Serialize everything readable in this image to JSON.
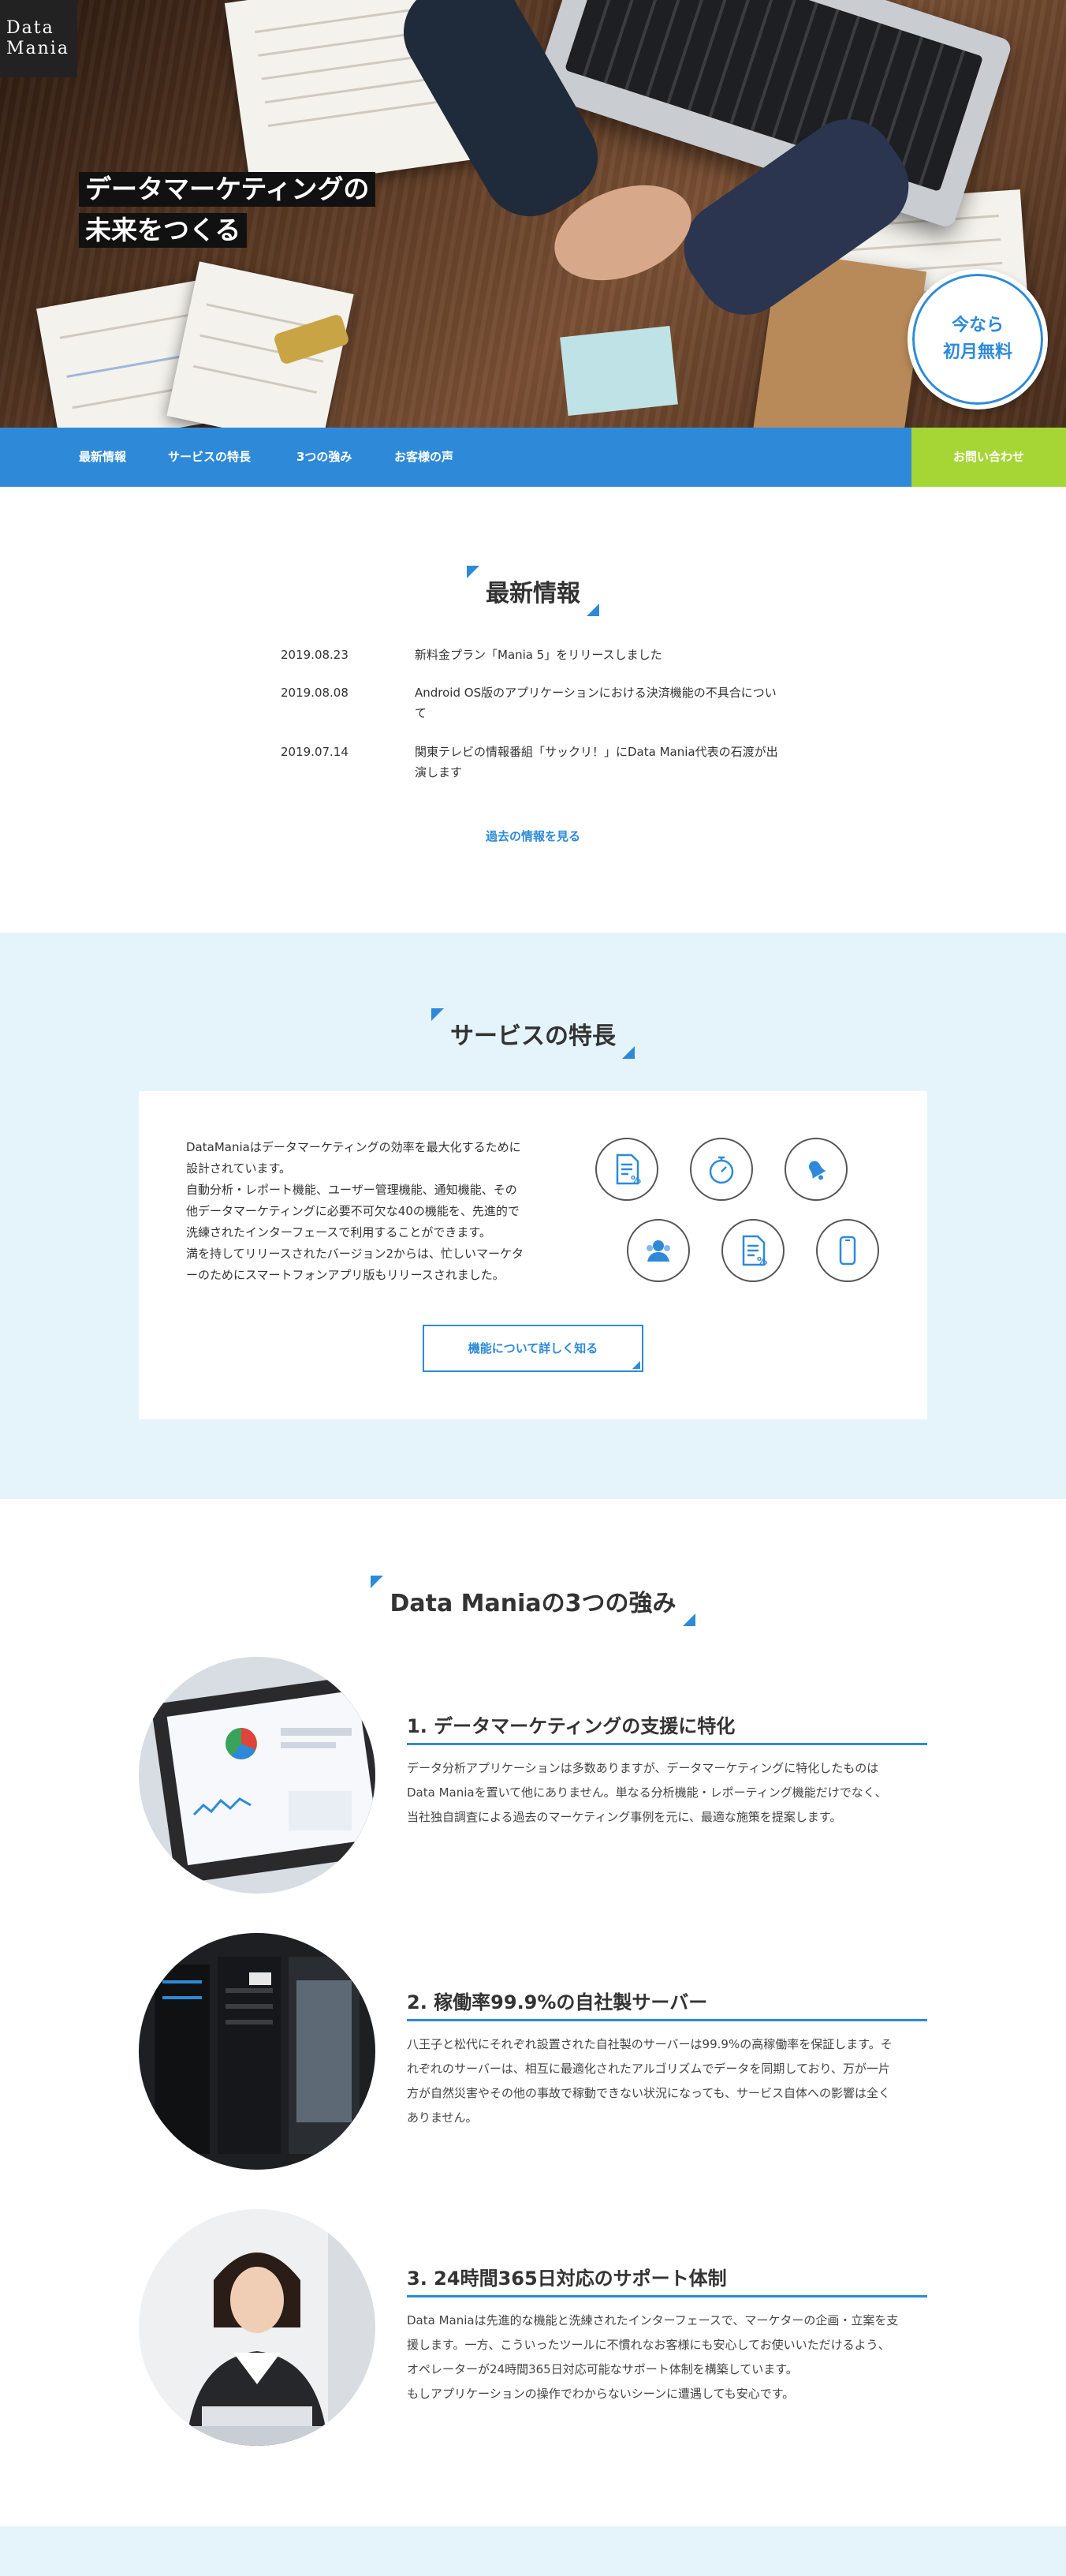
{
  "logo": {
    "line1": "Data",
    "line2": "Mania"
  },
  "hero": {
    "headline_line1": "データマーケティングの",
    "headline_line2": "未来をつくる",
    "badge_line1": "今なら",
    "badge_line2": "初月無料"
  },
  "nav": {
    "items": [
      {
        "label": "最新情報"
      },
      {
        "label": "サービスの特長"
      },
      {
        "label": "3つの強み"
      },
      {
        "label": "お客様の声"
      }
    ],
    "cta_label": "お問い合わせ"
  },
  "news": {
    "title": "最新情報",
    "items": [
      {
        "date": "2019.08.23",
        "text": "新料金プラン「Mania 5」をリリースしました"
      },
      {
        "date": "2019.08.08",
        "text": "Android OS版のアプリケーションにおける決済機能の不具合について"
      },
      {
        "date": "2019.07.14",
        "text": "関東テレビの情報番組「サックリ！」にData Mania代表の石渡が出演します"
      }
    ],
    "more_label": "過去の情報を見る"
  },
  "features": {
    "title": "サービスの特長",
    "description": "DataManiaはデータマーケティングの効率を最大化するために\n設計されています。\n自動分析・レポート機能、ユーザー管理機能、通知機能、その\n他データマーケティングに必要不可欠な40の機能を、先進的で\n洗練されたインターフェースで利用することができます。\n満を持してリリースされたバージョン2からは、忙しいマーケタ\nーのためにスマートフォンアプリ版もリリースされました。",
    "icons": [
      "report-icon",
      "stopwatch-icon",
      "notification-bell-icon",
      "user-management-icon",
      "analysis-document-icon",
      "smartphone-icon"
    ],
    "button_label": "機能について詳しく知る"
  },
  "strengths": {
    "title": "Data Maniaの3つの強み",
    "items": [
      {
        "title": "1. データマーケティングの支援に特化",
        "body": "データ分析アプリケーションは多数ありますが、データマーケティングに特化したものは\nData Maniaを置いて他にありません。単なる分析機能・レポーティング機能だけでなく、\n当社独自調査による過去のマーケティング事例を元に、最適な施策を提案します。"
      },
      {
        "title": "2. 稼働率99.9%の自社製サーバー",
        "body": "八王子と松代にそれぞれ設置された自社製のサーバーは99.9%の高稼働率を保証します。そ\nれぞれのサーバーは、相互に最適化されたアルゴリズムでデータを同期しており、万が一片\n方が自然災害やその他の事故で稼動できない状況になっても、サービス自体への影響は全く\nありません。"
      },
      {
        "title": "3. 24時間365日対応のサポート体制",
        "body": "Data Maniaは先進的な機能と洗練されたインターフェースで、マーケターの企画・立案を支\n援します。一方、こういったツールに不慣れなお客様にも安心してお使いいただけるよう、\nオペレーターが24時間365日対応可能なサポート体制を構築しています。\nもしアプリケーションの操作でわからないシーンに遭遇しても安心です。"
      }
    ]
  },
  "colors": {
    "accent": "#2e8ad8",
    "cta": "#a6d636",
    "section_bg": "#e5f4fb"
  }
}
